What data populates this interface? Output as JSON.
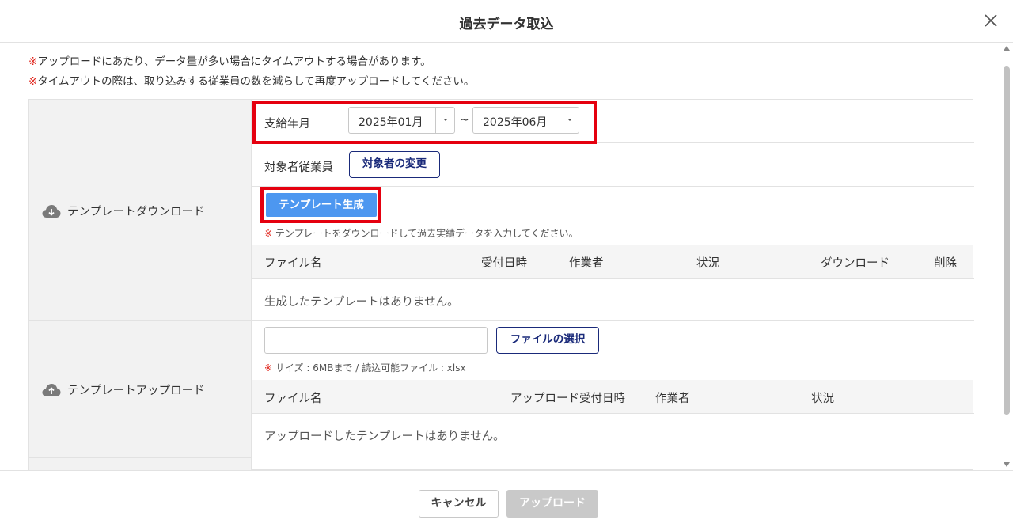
{
  "dialog": {
    "title": "過去データ取込"
  },
  "notices": {
    "mark": "※",
    "line1": "アップロードにあたり、データ量が多い場合にタイムアウトする場合があります。",
    "line2": "タイムアウトの際は、取り込みする従業員の数を減らして再度アップロードしてください。"
  },
  "download_section": {
    "label": "テンプレートダウンロード",
    "pay_month_label": "支給年月",
    "from_value": "2025年01月",
    "separator": "~",
    "to_value": "2025年06月",
    "target_label": "対象者従業員",
    "change_target_button": "対象者の変更",
    "generate_button": "テンプレート生成",
    "hint_mark": "※",
    "hint_text": "テンプレートをダウンロードして過去実績データを入力してください。",
    "columns": [
      "ファイル名",
      "受付日時",
      "作業者",
      "状況",
      "ダウンロード",
      "削除"
    ],
    "empty_message": "生成したテンプレートはありません。"
  },
  "upload_section": {
    "label": "テンプレートアップロード",
    "file_input_value": "",
    "select_file_button": "ファイルの選択",
    "hint_mark": "※",
    "hint_text": "サイズ : 6MBまで / 読込可能ファイル : xlsx",
    "columns": [
      "ファイル名",
      "アップロード受付日時",
      "作業者",
      "状況"
    ],
    "empty_message": "アップロードしたテンプレートはありません。"
  },
  "footer": {
    "cancel_button": "キャンセル",
    "upload_button": "アップロード"
  },
  "colors": {
    "highlight_border": "#e5000f",
    "primary_button": "#4d97f0",
    "outline_button": "#1a2a7a",
    "notice_mark": "#e0241b",
    "disabled_button": "#c9c9c9"
  },
  "icons": {
    "close": "close-icon",
    "download_section": "cloud-download-icon",
    "upload_section": "cloud-upload-icon"
  }
}
